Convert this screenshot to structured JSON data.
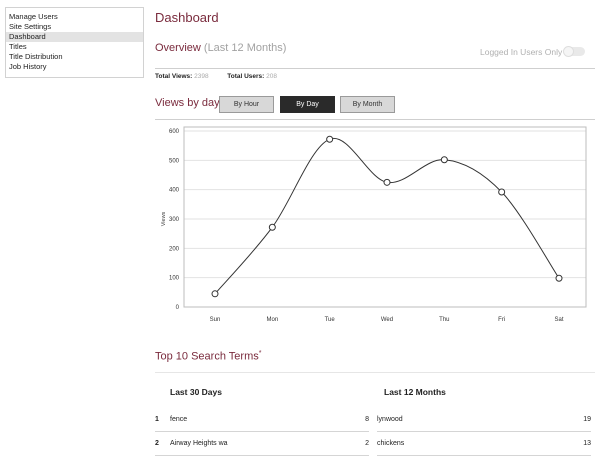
{
  "sidebar": {
    "items": [
      {
        "label": "Manage Users"
      },
      {
        "label": "Site Settings"
      },
      {
        "label": "Dashboard",
        "active": true
      },
      {
        "label": "Titles"
      },
      {
        "label": "Title Distribution"
      },
      {
        "label": "Job History"
      }
    ]
  },
  "page_title": "Dashboard",
  "overview": {
    "title": "Overview",
    "subtitle": "(Last 12 Months)",
    "logged_in_label": "Logged In Users Only",
    "logged_in_only": false,
    "total_views_label": "Total Views:",
    "total_views": "2398",
    "total_users_label": "Total Users:",
    "total_users": "208"
  },
  "views": {
    "title": "Views by day",
    "buttons": [
      "By Hour",
      "By Day",
      "By Month"
    ],
    "active_button": "By Day"
  },
  "chart_data": {
    "type": "line",
    "categories": [
      "Sun",
      "Mon",
      "Tue",
      "Wed",
      "Thu",
      "Fri",
      "Sat"
    ],
    "values": [
      45,
      272,
      572,
      425,
      502,
      392,
      98
    ],
    "ylabel": "Views",
    "ylim": [
      0,
      600
    ],
    "yticks": [
      0,
      100,
      200,
      300,
      400,
      500,
      600
    ],
    "grid": true,
    "line_color": "#333333"
  },
  "search": {
    "title": "Top 10 Search Terms",
    "note_mark": "*",
    "columns": [
      {
        "heading": "Last 30 Days",
        "rows": [
          {
            "rank": "1",
            "term": "fence",
            "count": "8"
          },
          {
            "rank": "2",
            "term": "Airway Heights wa",
            "count": "2"
          }
        ]
      },
      {
        "heading": "Last 12 Months",
        "rows": [
          {
            "rank": "",
            "term": "lynwood",
            "count": "19"
          },
          {
            "rank": "",
            "term": "chickens",
            "count": "13"
          }
        ]
      }
    ]
  },
  "colors": {
    "accent": "#7a2b3d",
    "active_button": "#2a2a2a",
    "button": "#d8d8d8"
  }
}
